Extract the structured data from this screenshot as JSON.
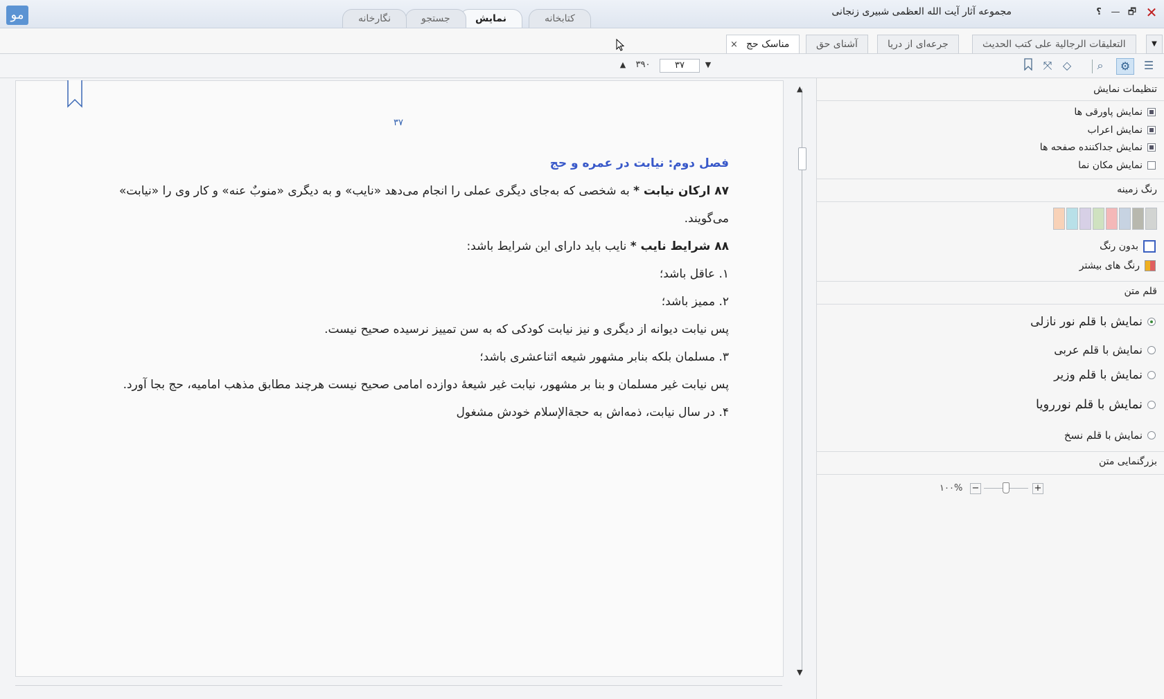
{
  "window": {
    "title": "مجموعه آثار آیت الله العظمی شبیری زنجانی",
    "logo_glyph": "ﻣﻮ",
    "controls": {
      "close": "✕",
      "restore": "🗗",
      "minimize": "—",
      "help": "؟"
    }
  },
  "main_tabs": [
    {
      "label": "کتابخانه",
      "active": false
    },
    {
      "label": "نمایش",
      "active": true
    },
    {
      "label": "جستجو",
      "active": false
    },
    {
      "label": "نگارخانه",
      "active": false
    }
  ],
  "doc_tabs": [
    {
      "label": "التعلیقات الرجالیة علی کتب الحدیث",
      "active": false
    },
    {
      "label": "جرعه‌ای از دریا",
      "active": false
    },
    {
      "label": "آشنای حق",
      "active": false
    },
    {
      "label": "مناسک حج",
      "active": true
    }
  ],
  "doc_tab_close": "×",
  "toolbar": {
    "icons": [
      "list-icon",
      "settings-icon",
      "search-icon",
      "eraser-icon",
      "fullscreen-icon",
      "bookmark-icon"
    ],
    "page_current": "۳۷",
    "page_total": "۳۹۰"
  },
  "page": {
    "page_number": "۳۷",
    "heading": "فصل دوم: نیابت در عمره و حج",
    "para1_bold": "۸۷ ارکان نیابت *",
    "para1_text": " به شخصی که به‌جای دیگری عملی را انجام می‌دهد «نایب» و به دیگری «منوبٌ عنه» و کار وی را «نیابت»",
    "para1_cont": "می‌گویند.",
    "para2_bold": "۸۸ شرایط نایب *",
    "para2_text": " نایب باید دارای این شرایط باشد:",
    "item1": "۱. عاقل باشد؛",
    "item2": "۲. ممیز باشد؛",
    "note2": "پس نیابت دیوانه از دیگری و نیز نیابت کودکی که به سن تمییز نرسیده صحیح نیست.",
    "item3": "۳. مسلمان بلکه بنابر مشهور شیعه اثناعشری باشد؛",
    "note3": "پس نیابت غیر مسلمان و بنا بر مشهور، نیابت غیر شیعهٔ دوازده امامی صحیح نیست هرچند مطابق مذهب امامیه، حج بجا آورد.",
    "item4": "۴. در سال نیابت، ذمه‌اش به حجةالإسلام خودش مشغول"
  },
  "settings_panel": {
    "display_title": "تنظیمات نمایش",
    "display_options": [
      {
        "label": "نمایش پاورقی ها",
        "checked": true
      },
      {
        "label": "نمایش اعراب",
        "checked": true
      },
      {
        "label": "نمایش جداکننده صفحه ها",
        "checked": true
      },
      {
        "label": "نمایش مکان نما",
        "checked": false
      }
    ],
    "bg_title": "رنگ زمینه",
    "bg_swatches": [
      "#d2d4d2",
      "#b8b8ae",
      "#c7d3e2",
      "#f4b8b8",
      "#cfe2c0",
      "#d7d0e6",
      "#b8e0e8",
      "#f8d2b8"
    ],
    "no_color": "بدون رنگ",
    "more_colors": "رنگ های بیشتر",
    "font_title": "قلم متن",
    "font_options": [
      {
        "label": "نمایش با قلم نور نازلی",
        "checked": true
      },
      {
        "label": "نمایش با قلم عربی",
        "checked": false
      },
      {
        "label": "نمایش با قلم وزیر",
        "checked": false
      },
      {
        "label": "نمایش با قلم نوررویا",
        "checked": false
      },
      {
        "label": "نمایش با قلم نسخ",
        "checked": false
      }
    ],
    "zoom_title": "بزرگنمایی متن",
    "zoom_value": "۱۰۰%",
    "zoom_level_percent": 100,
    "zoom_plus": "+",
    "zoom_minus": "−"
  },
  "colors": {
    "accent": "#3858c9",
    "heading": "#3858c9",
    "page_number": "#2f5fb0"
  }
}
